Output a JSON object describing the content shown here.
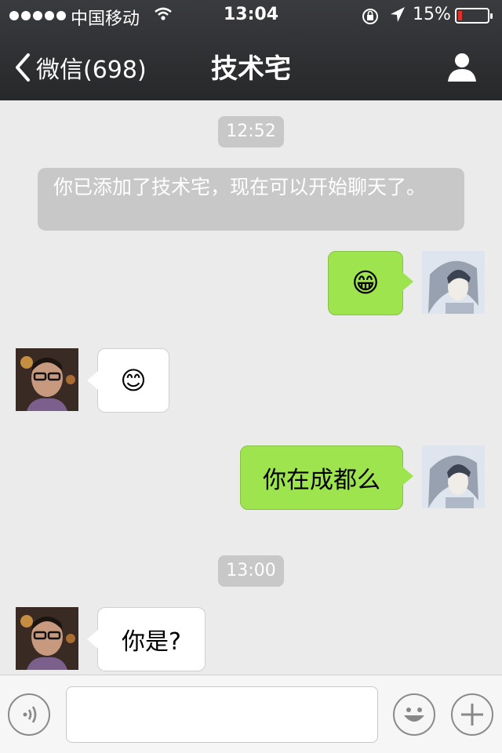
{
  "status_bar": {
    "carrier": "中国移动",
    "time": "13:04",
    "battery": "15%",
    "battery_level": 0.15,
    "signal_dots": 5,
    "icons": [
      "wifi-icon",
      "rotation-lock-icon",
      "location-arrow-icon",
      "battery-icon"
    ]
  },
  "nav": {
    "back_label": "微信(698)",
    "title": "技术宅",
    "icons": [
      "chevron-left-icon",
      "person-icon"
    ]
  },
  "chat": {
    "stamp1": "12:52",
    "system_message": "你已添加了技术宅，现在可以开始聊天了。",
    "msg1_emoji": "😁",
    "msg2_emoji": "😊",
    "msg3_text": "你在成都么",
    "stamp2": "13:00",
    "msg4_text": "你是?"
  },
  "input": {
    "value": "",
    "placeholder": "",
    "icons": [
      "voice-icon",
      "emoji-icon",
      "plus-icon"
    ]
  },
  "colors": {
    "topbar": "#2f3033",
    "outgoing_bubble": "#9de44e",
    "incoming_bubble": "#ffffff",
    "chat_background": "#ebebeb",
    "battery_low": "#e0302a"
  }
}
